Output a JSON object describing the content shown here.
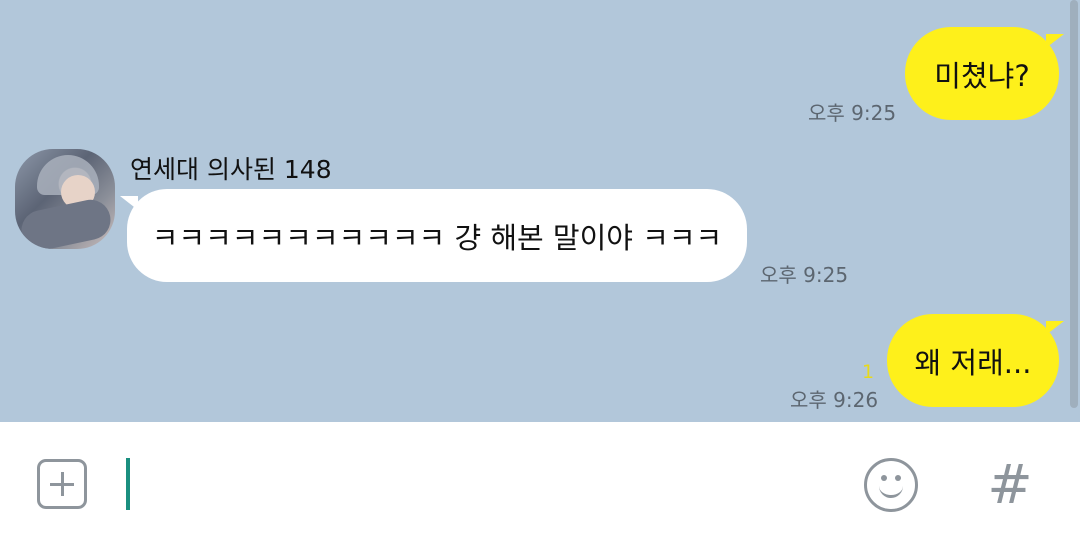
{
  "chat": {
    "messages": [
      {
        "side": "me",
        "text": "미쳤냐?",
        "time": "오후 9:25",
        "unread": ""
      },
      {
        "side": "other",
        "sender": "연세대 의사된 148",
        "text": "ㅋㅋㅋㅋㅋㅋㅋㅋㅋㅋㅋ 걍 해본 말이야 ㅋㅋㅋ",
        "time": "오후 9:25"
      },
      {
        "side": "me",
        "text": "왜 저래...",
        "time": "오후 9:26",
        "unread": "1"
      }
    ]
  },
  "colors": {
    "chat_background": "#b2c7da",
    "my_bubble": "#fef01b",
    "other_bubble": "#ffffff",
    "cursor": "#1a8f7f",
    "icon": "#8e959c"
  },
  "input_bar": {
    "icons": [
      "plus-icon",
      "emoji-icon",
      "hashtag-icon"
    ],
    "hash_glyph": "#",
    "value": ""
  }
}
